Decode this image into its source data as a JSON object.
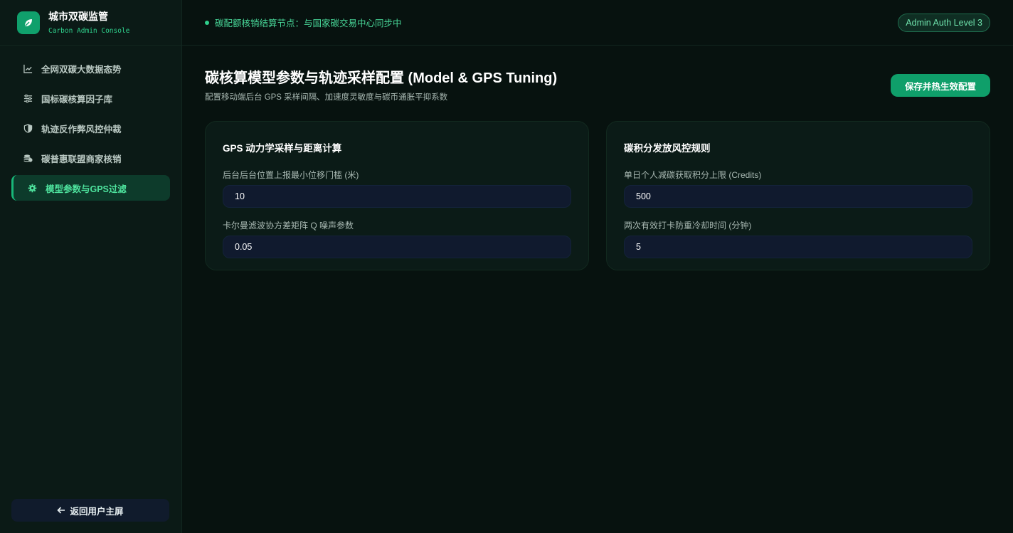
{
  "brand": {
    "title": "城市双碳监管",
    "subtitle": "Carbon Admin Console"
  },
  "sidebar": {
    "items": [
      {
        "label": "全网双碳大数据态势",
        "icon": "chart-line-icon"
      },
      {
        "label": "国标碳核算因子库",
        "icon": "sliders-icon"
      },
      {
        "label": "轨迹反作弊风控仲裁",
        "icon": "shield-icon"
      },
      {
        "label": "碳普惠联盟商家核销",
        "icon": "coins-icon"
      },
      {
        "label": "模型参数与GPS过滤",
        "icon": "gear-icon",
        "active": true
      }
    ],
    "back_label": "返回用户主屏"
  },
  "topbar": {
    "status_text": "碳配额核销结算节点：与国家碳交易中心同步中",
    "auth_badge": "Admin Auth Level 3"
  },
  "page": {
    "title": "碳核算模型参数与轨迹采样配置 (Model & GPS Tuning)",
    "subtitle": "配置移动端后台 GPS 采样间隔、加速度灵敏度与碳币通胀平抑系数",
    "save_label": "保存并热生效配置"
  },
  "cards": [
    {
      "title": "GPS 动力学采样与距离计算",
      "fields": [
        {
          "label": "后台后台位置上报最小位移门槛 (米)",
          "value": "10"
        },
        {
          "label": "卡尔曼滤波协方差矩阵 Q 噪声参数",
          "value": "0.05"
        }
      ]
    },
    {
      "title": "碳积分发放风控规则",
      "fields": [
        {
          "label": "单日个人减碳获取积分上限 (Credits)",
          "value": "500"
        },
        {
          "label": "两次有效打卡防重冷却时间 (分钟)",
          "value": "5"
        }
      ]
    }
  ],
  "colors": {
    "accent": "#10a06c",
    "active_text": "#4ee39e",
    "background": "#07120f"
  }
}
